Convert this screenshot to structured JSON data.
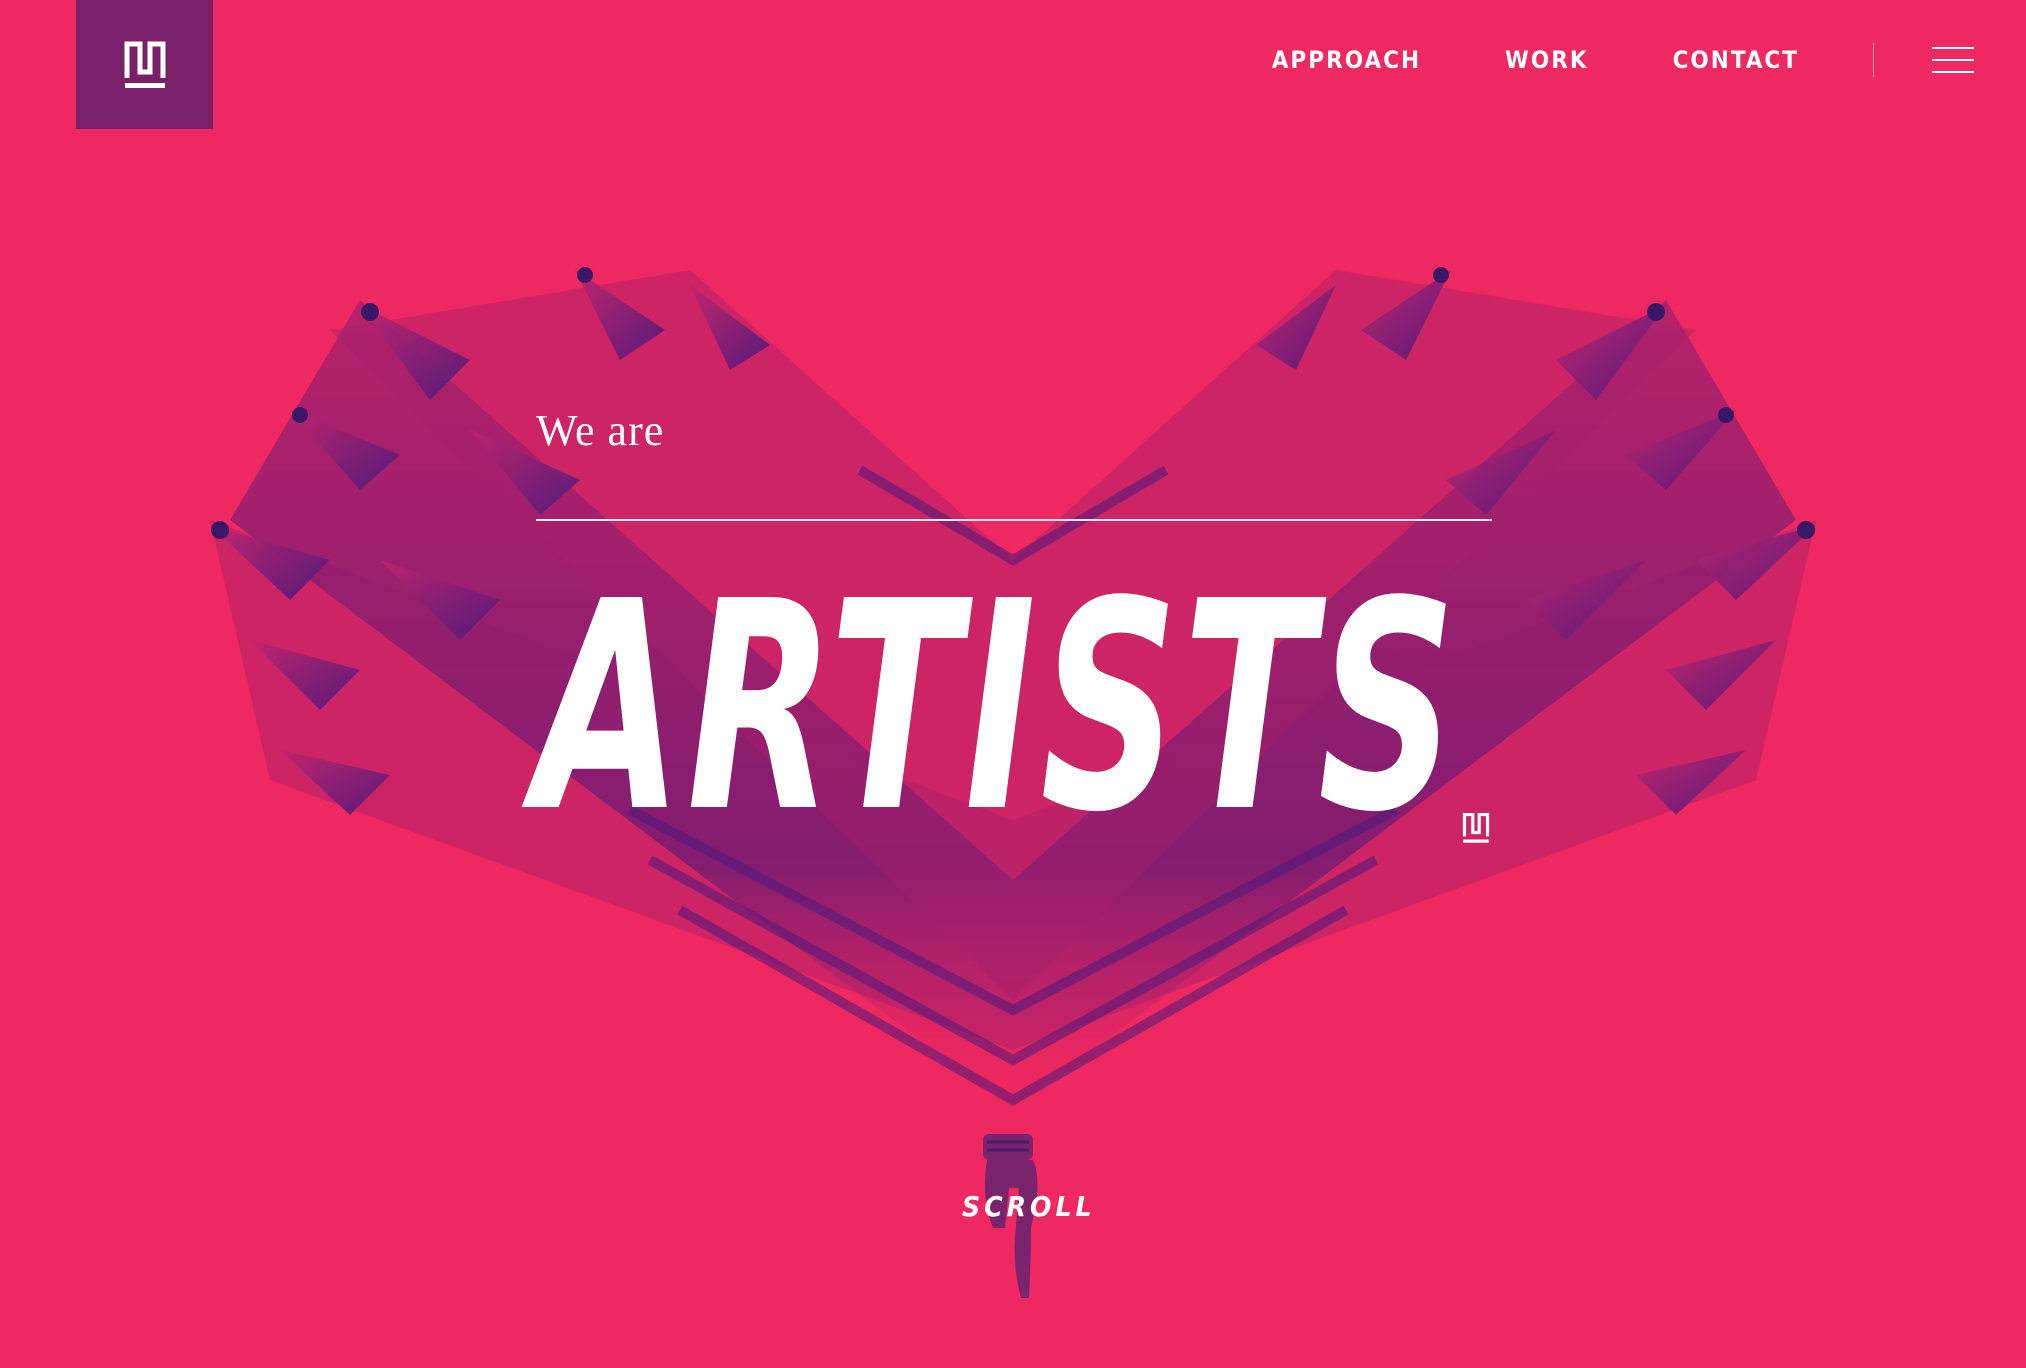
{
  "brand": {
    "logo_icon": "monogram-logo-icon",
    "accent": "#ee2860",
    "logo_bg": "#7a1f6a"
  },
  "nav": {
    "items": [
      {
        "label": "APPROACH"
      },
      {
        "label": "WORK"
      },
      {
        "label": "CONTACT"
      }
    ],
    "menu_icon": "hamburger-menu-icon"
  },
  "hero": {
    "intro": "We are",
    "headline": "ARTISTS",
    "background": "pencil-tips-wings-illustration",
    "scroll_label": "SCROLL",
    "scroll_icon": "pointing-hand-icon"
  }
}
